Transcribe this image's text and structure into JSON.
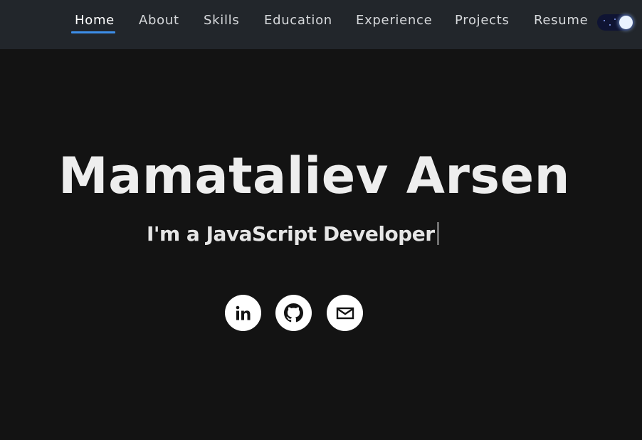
{
  "nav": {
    "items": [
      {
        "label": "Home",
        "active": true
      },
      {
        "label": "About"
      },
      {
        "label": "Skills"
      },
      {
        "label": "Education"
      },
      {
        "label": "Experience"
      },
      {
        "label": "Projects"
      },
      {
        "label": "Resume"
      }
    ],
    "theme_toggle": {
      "state": "dark",
      "icon": "moon-toggle-icon"
    }
  },
  "hero": {
    "name": "Mamataliev Arsen",
    "subtitle_prefix": "I'm a ",
    "subtitle_role": "JavaScript Developer"
  },
  "social": [
    {
      "icon": "linkedin-icon"
    },
    {
      "icon": "github-icon"
    },
    {
      "icon": "mail-icon"
    }
  ],
  "colors": {
    "background": "#131313",
    "navbar": "#22262b",
    "accent": "#3d8ee8",
    "text": "#eeeeee"
  }
}
